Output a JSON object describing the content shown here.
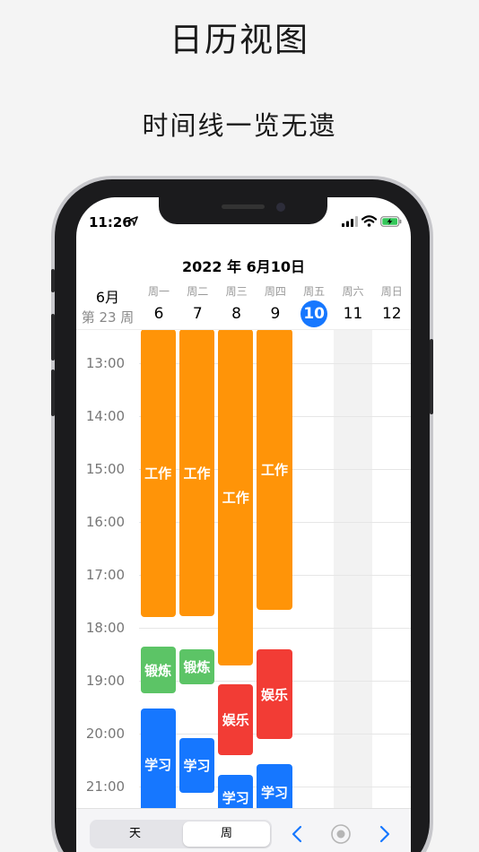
{
  "promo": {
    "title": "日历视图",
    "subtitle": "时间线一览无遗"
  },
  "status_bar": {
    "time": "11:26",
    "icons": [
      "location-arrow-icon",
      "cellular-signal-icon",
      "wifi-icon",
      "battery-charging-icon"
    ]
  },
  "header": {
    "date_title": "2022 年 6月10日",
    "month": "6月",
    "week": "第 23 周"
  },
  "days": [
    {
      "name": "周一",
      "num": "6"
    },
    {
      "name": "周二",
      "num": "7"
    },
    {
      "name": "周三",
      "num": "8"
    },
    {
      "name": "周四",
      "num": "9"
    },
    {
      "name": "周五",
      "num": "10",
      "today": true
    },
    {
      "name": "周六",
      "num": "11",
      "weekend": true
    },
    {
      "name": "周日",
      "num": "12",
      "weekend": true
    }
  ],
  "hours": [
    "13:00",
    "14:00",
    "15:00",
    "16:00",
    "17:00",
    "18:00",
    "19:00",
    "20:00",
    "21:00"
  ],
  "events": [
    {
      "day": 0,
      "label": "工作",
      "start": "12:22",
      "end": "17:48",
      "category": "work"
    },
    {
      "day": 1,
      "label": "工作",
      "start": "12:22",
      "end": "17:47",
      "category": "work"
    },
    {
      "day": 2,
      "label": "工作",
      "start": "12:22",
      "end": "18:43",
      "category": "work"
    },
    {
      "day": 3,
      "label": "工作",
      "start": "12:22",
      "end": "17:40",
      "category": "work"
    },
    {
      "day": 0,
      "label": "锻炼",
      "start": "18:22",
      "end": "19:15",
      "category": "exercise"
    },
    {
      "day": 1,
      "label": "锻炼",
      "start": "18:25",
      "end": "19:05",
      "category": "exercise"
    },
    {
      "day": 2,
      "label": "娱乐",
      "start": "19:05",
      "end": "20:25",
      "category": "leisure"
    },
    {
      "day": 3,
      "label": "娱乐",
      "start": "18:25",
      "end": "20:07",
      "category": "leisure"
    },
    {
      "day": 0,
      "label": "学习",
      "start": "19:32",
      "end": "21:40",
      "category": "study"
    },
    {
      "day": 1,
      "label": "学习",
      "start": "20:06",
      "end": "21:08",
      "category": "study"
    },
    {
      "day": 2,
      "label": "学习",
      "start": "20:47",
      "end": "21:40",
      "category": "study"
    },
    {
      "day": 3,
      "label": "学习",
      "start": "20:35",
      "end": "21:40",
      "category": "study"
    }
  ],
  "colors": {
    "work": "#ff9408",
    "exercise": "#5cc466",
    "leisure": "#f23c35",
    "study": "#1677ff",
    "today_accent": "#1677ff"
  },
  "toolbar": {
    "view_day": "天",
    "view_week": "周",
    "selected_view": "周",
    "icons": [
      "chevron-left-icon",
      "today-target-icon",
      "chevron-right-icon"
    ]
  }
}
